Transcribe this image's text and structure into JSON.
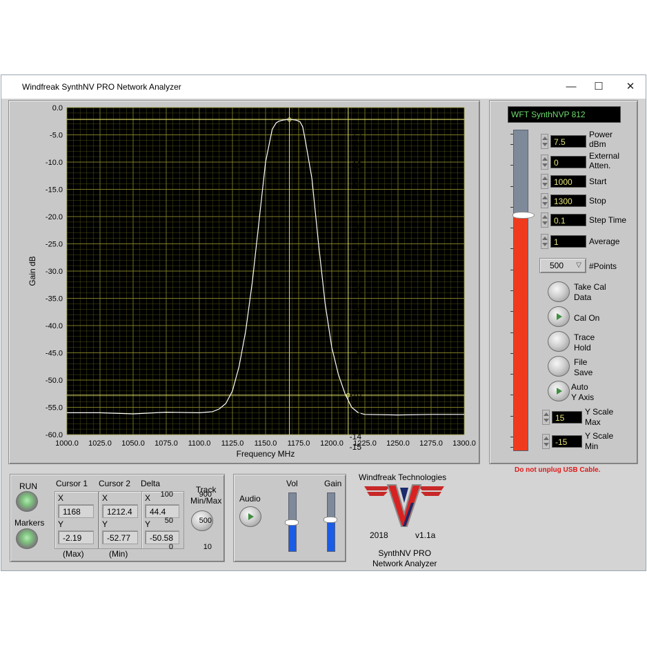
{
  "window": {
    "title": "Windfreak SynthNV PRO Network Analyzer",
    "controls": {
      "minimize": "—",
      "maximize": "☐",
      "close": "✕"
    }
  },
  "chart_data": {
    "type": "line",
    "xlabel": "Frequency MHz",
    "ylabel": "Gain dB",
    "xlim": [
      1000,
      1300
    ],
    "ylim": [
      -60,
      0
    ],
    "x_ticks": [
      "1000.0",
      "1025.0",
      "1050.0",
      "1075.0",
      "1100.0",
      "1125.0",
      "1150.0",
      "1175.0",
      "1200.0",
      "1225.0",
      "1250.0",
      "1275.0",
      "1300.0"
    ],
    "y_ticks": [
      "0.0",
      "-5.0",
      "-10.0",
      "-15.0",
      "-20.0",
      "-25.0",
      "-30.0",
      "-35.0",
      "-40.0",
      "-45.0",
      "-50.0",
      "-55.0",
      "-60.0"
    ],
    "grid": true,
    "background": "#000000",
    "grid_color": "#8a8a2a",
    "trace_color": "#ffffff",
    "series": [
      {
        "x": [
          1000,
          1025,
          1050,
          1075,
          1100,
          1110,
          1115,
          1120,
          1125,
          1130,
          1135,
          1140,
          1145,
          1150,
          1155,
          1158,
          1160,
          1163,
          1166,
          1168,
          1170,
          1173,
          1176,
          1178,
          1180,
          1185,
          1190,
          1195,
          1200,
          1205,
          1210,
          1215,
          1220,
          1225,
          1250,
          1275,
          1300
        ],
        "y": [
          -56.0,
          -56.0,
          -56.2,
          -55.9,
          -56.0,
          -55.8,
          -55.3,
          -54.3,
          -52.0,
          -47.5,
          -41.0,
          -32.0,
          -21.0,
          -10.0,
          -4.0,
          -2.8,
          -2.5,
          -2.3,
          -2.2,
          -2.19,
          -2.2,
          -2.3,
          -2.6,
          -3.5,
          -6.0,
          -13.0,
          -25.0,
          -36.0,
          -44.0,
          -49.0,
          -52.5,
          -55.0,
          -56.0,
          -56.3,
          -56.4,
          -56.3,
          -56.3
        ]
      }
    ],
    "cursors": {
      "cursor1": {
        "x": 1168,
        "y": -2.19
      },
      "cursor2": {
        "x": 1212.4,
        "y": -52.77
      }
    }
  },
  "device": {
    "name": "WFT SynthNVP 812"
  },
  "power_slider": {
    "ticks": [
      "15",
      "14",
      "12",
      "10",
      "8",
      "6",
      "4",
      "2",
      "0",
      "-2",
      "-4",
      "-6",
      "-8",
      "-10",
      "-12",
      "-14",
      "-15"
    ],
    "value": 7.5,
    "min": -15,
    "max": 15,
    "fill_color": "#f03a1e"
  },
  "settings": {
    "power": {
      "value": "7.5",
      "label": "Power\ndBm"
    },
    "ext_atten": {
      "value": "0",
      "label": "External\nAtten."
    },
    "start": {
      "value": "1000",
      "label": "Start"
    },
    "stop": {
      "value": "1300",
      "label": "Stop"
    },
    "step_time": {
      "value": "0.1",
      "label": "Step Time"
    },
    "average": {
      "value": "1",
      "label": "Average"
    },
    "points": {
      "value": "500",
      "label": "#Points"
    }
  },
  "buttons": {
    "take_cal": "Take Cal\nData",
    "cal_on": "Cal On",
    "trace_hold": "Trace\nHold",
    "file_save": "File\nSave",
    "auto_y": "Auto\nY Axis"
  },
  "yscale": {
    "max": {
      "value": "15",
      "label": "Y Scale\nMax"
    },
    "min": {
      "value": "-15",
      "label": "Y Scale\nMin"
    }
  },
  "warning": "Do not unplug USB Cable.",
  "markers_panel": {
    "run": "RUN",
    "markers": "Markers",
    "cursor1": {
      "title": "Cursor 1",
      "x_label": "X",
      "x": "1168",
      "y_label": "Y",
      "y": "-2.19",
      "note": "(Max)"
    },
    "cursor2": {
      "title": "Cursor 2",
      "x_label": "X",
      "x": "1212.4",
      "y_label": "Y",
      "y": "-52.77",
      "note": "(Min)"
    },
    "delta": {
      "title": "Delta",
      "x_label": "X",
      "x": "44.4",
      "y_label": "Y",
      "y": "-50.58"
    },
    "track": "Track\nMin/Max"
  },
  "audio_panel": {
    "audio": "Audio",
    "vol": {
      "label": "Vol",
      "ticks": [
        "100",
        "50",
        "0"
      ],
      "value": 50,
      "min": 0,
      "max": 100
    },
    "gain": {
      "label": "Gain",
      "ticks": [
        "900",
        "500",
        "10"
      ],
      "value": 500,
      "min": 10,
      "max": 900
    }
  },
  "branding": {
    "company": "Windfreak Technologies",
    "year": "2018",
    "version": "v1.1a",
    "product": "SynthNV PRO\nNetwork Analyzer"
  }
}
